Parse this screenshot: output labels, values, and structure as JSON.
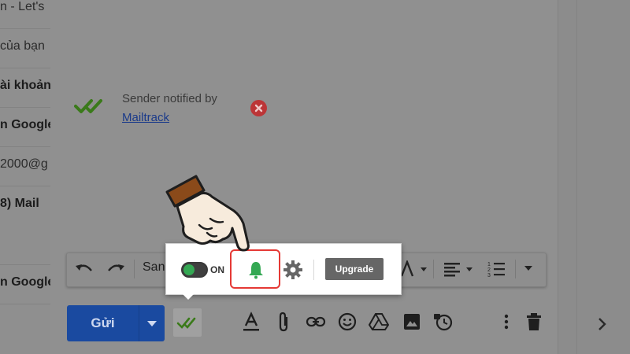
{
  "inbox": {
    "rows": [
      {
        "text": "n - Let's",
        "style": "light"
      },
      {
        "text": "của bạn",
        "style": "light"
      },
      {
        "text": "ài khoản",
        "style": "bold"
      },
      {
        "text": "n Google",
        "style": "bold"
      },
      {
        "text": "2000@g",
        "style": "light"
      },
      {
        "text": "8) Mail",
        "style": "bold"
      },
      {
        "text": "",
        "style": "light"
      },
      {
        "text": "n Google",
        "style": "bold"
      }
    ]
  },
  "notice": {
    "line1": "Sender notified by",
    "link": "Mailtrack",
    "check_icon": "double-check-icon",
    "close_icon": "close-circle-icon"
  },
  "format_toolbar": {
    "font_name": "San"
  },
  "mailtrack_popup": {
    "toggle_label": "ON",
    "toggle_state": "on",
    "upgrade_label": "Upgrade",
    "bell_icon": "bell-icon",
    "gear_icon": "gear-icon"
  },
  "action_bar": {
    "send_label": "Gửi",
    "icons": [
      "text-format-icon",
      "attach-icon",
      "link-icon",
      "emoji-icon",
      "drive-icon",
      "photo-icon",
      "schedule-lock-icon",
      "more-vert-icon",
      "trash-icon"
    ]
  },
  "colors": {
    "send_blue": "#1a4aa0",
    "bell_green": "#34a853",
    "highlight_red": "#e53935",
    "check_green": "#3a7a1a"
  }
}
